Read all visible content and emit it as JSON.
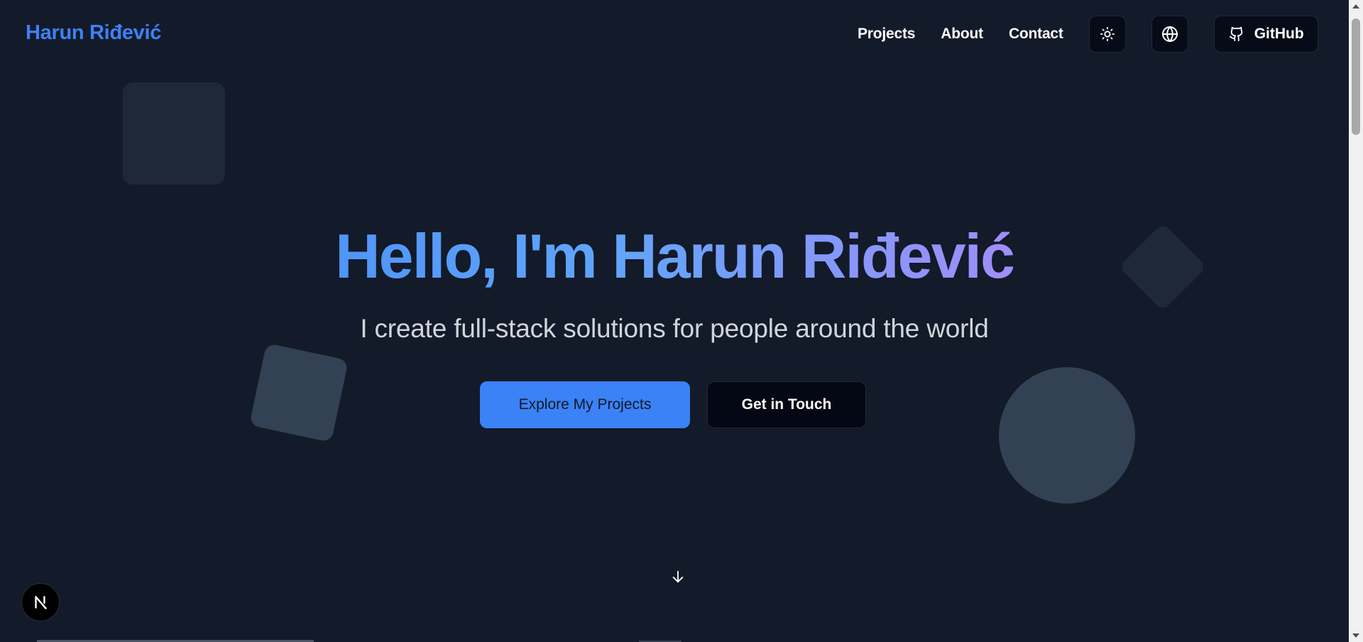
{
  "header": {
    "brand": "Harun Riđević",
    "nav": [
      "Projects",
      "About",
      "Contact"
    ],
    "github_label": "GitHub"
  },
  "hero": {
    "title": "Hello, I'm Harun Riđević",
    "subtitle": "I create full-stack solutions for people around the world",
    "primary_cta": "Explore My Projects",
    "secondary_cta": "Get in Touch"
  },
  "icons": {
    "theme": "sun-icon",
    "language": "globe-icon",
    "github": "github-icon",
    "scroll": "arrow-down-icon",
    "framework_badge": "nextjs-icon"
  },
  "colors": {
    "background": "#131a29",
    "accent": "#3b82f6",
    "gradient_end": "#c084fc"
  }
}
